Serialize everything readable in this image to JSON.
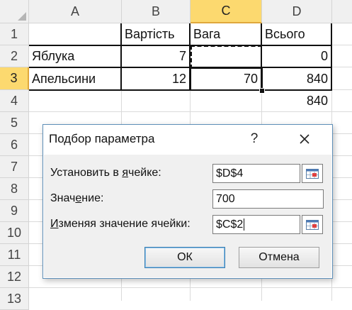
{
  "sheet": {
    "columns": [
      "A",
      "B",
      "C",
      "D"
    ],
    "active_column": "C",
    "rows": [
      "1",
      "2",
      "3",
      "4",
      "5",
      "6",
      "7",
      "8",
      "9",
      "10",
      "11",
      "12",
      "13"
    ],
    "active_row": "3",
    "cells": {
      "B1": "Вартість",
      "C1": "Вага",
      "D1": "Всього",
      "A2": "Яблука",
      "B2": "7",
      "C2": "",
      "D2": "0",
      "A3": "Апельсини",
      "B3": "12",
      "C3": "70",
      "D3": "840",
      "D4": "840"
    },
    "colors": {
      "active_header": "#fcd96f",
      "header_bg": "#f0f0f0",
      "grid": "#dadada"
    }
  },
  "dialog": {
    "title": "Подбор параметра",
    "help_label": "?",
    "close_label": "✕",
    "set_cell_label_pre": "Установить в ",
    "set_cell_label_u": "я",
    "set_cell_label_post": "чейке:",
    "set_cell_value": "$D$4",
    "value_label_pre": "Знач",
    "value_label_u": "е",
    "value_label_post": "ние:",
    "value_value": "700",
    "changing_label_pre": "",
    "changing_label_u": "И",
    "changing_label_post": "зменяя значение ячейки:",
    "changing_value": "$C$2",
    "ok_label": "ОК",
    "cancel_label": "Отмена",
    "ref_icon": "collapse-dialog-icon",
    "accent": "#3c7fb1"
  }
}
